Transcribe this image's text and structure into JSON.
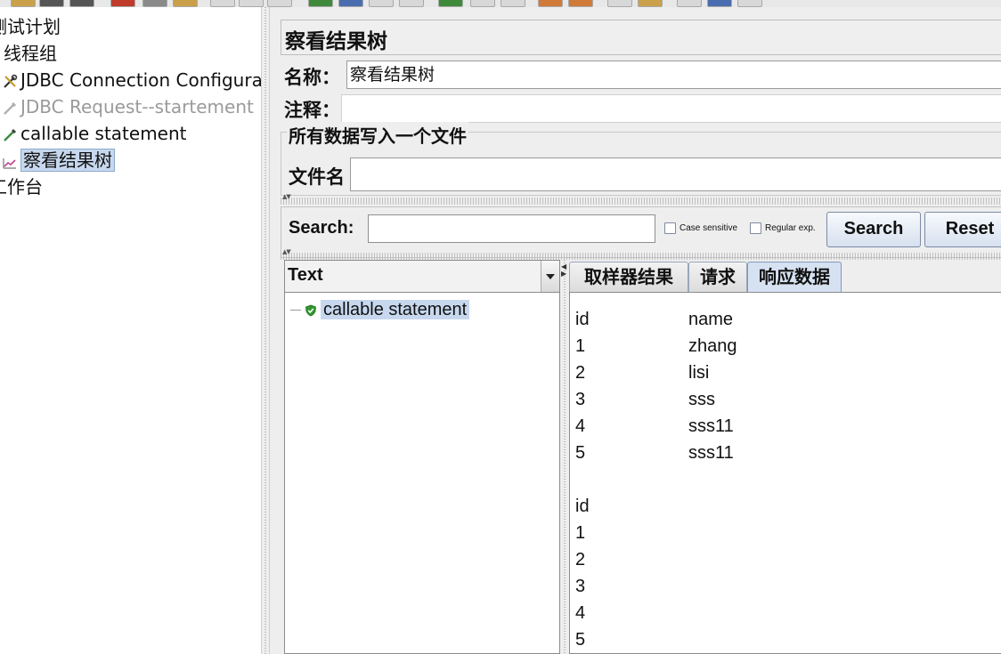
{
  "tree": {
    "items": [
      {
        "label": "测试计划"
      },
      {
        "label": "线程组"
      },
      {
        "label": "JDBC Connection Configuration"
      },
      {
        "label": "JDBC Request--startement"
      },
      {
        "label": "callable statement"
      },
      {
        "label": "察看结果树"
      },
      {
        "label": "工作台"
      }
    ]
  },
  "panel": {
    "title": "察看结果树",
    "name_label": "名称：",
    "name_value": "察看结果树",
    "comment_label": "注释：",
    "comment_value": "",
    "file_group_title": "所有数据写入一个文件",
    "filename_label": "文件名",
    "filename_value": ""
  },
  "search": {
    "label": "Search:",
    "value": "",
    "case_sensitive_label": "Case sensitive",
    "regex_label": "Regular exp.",
    "search_button": "Search",
    "reset_button": "Reset"
  },
  "results": {
    "renderer": "Text",
    "nodes": [
      {
        "label": "callable statement",
        "status": "success"
      }
    ]
  },
  "tabs": [
    {
      "label": "取样器结果",
      "active": false
    },
    {
      "label": "请求",
      "active": false
    },
    {
      "label": "响应数据",
      "active": true
    }
  ],
  "response": {
    "rows": [
      [
        "id",
        "name"
      ],
      [
        "1",
        "zhang"
      ],
      [
        "2",
        "lisi"
      ],
      [
        "3",
        "sss"
      ],
      [
        "4",
        "sss11"
      ],
      [
        "5",
        "sss11"
      ],
      [
        "",
        ""
      ],
      [
        "id",
        ""
      ],
      [
        "1",
        ""
      ],
      [
        "2",
        ""
      ],
      [
        "3",
        ""
      ],
      [
        "4",
        ""
      ],
      [
        "5",
        ""
      ]
    ]
  },
  "colors": {
    "selection": "#c7d8ee",
    "panel_bg": "#eeeeee",
    "success_shield": "#2e9a2e"
  },
  "icons": {
    "tool": "wrench-icon",
    "pipette": "pipette-icon",
    "chart": "chart-icon",
    "shield": "shield-check-icon"
  }
}
